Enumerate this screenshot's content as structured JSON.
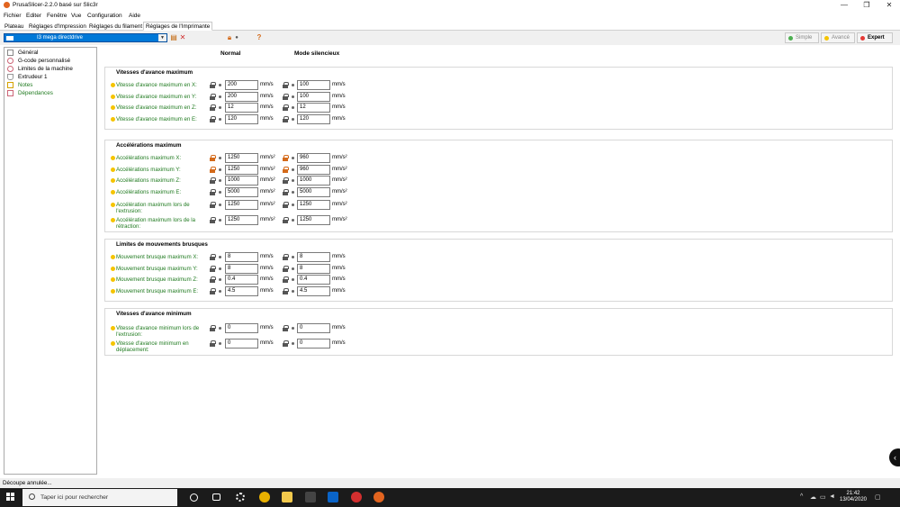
{
  "window": {
    "title": "PrusaSlicer-2.2.0 basé sur Slic3r",
    "minimize": "—",
    "maximize": "❐",
    "close": "✕"
  },
  "menu": [
    "Fichier",
    "Editer",
    "Fenêtre",
    "Vue",
    "Configuration",
    "Aide"
  ],
  "tabs": [
    "Plateau",
    "Réglages d'Impression",
    "Réglages du filament",
    "Réglages de l'Imprimante"
  ],
  "toolbar": {
    "preset_name": "I3 mega directdrive",
    "help_icon": "question-icon",
    "modes": [
      {
        "label": "Simple",
        "color": "#4caf50",
        "active": false
      },
      {
        "label": "Avancé",
        "color": "#f5c400",
        "active": false
      },
      {
        "label": "Expert",
        "color": "#e53935",
        "active": true
      }
    ]
  },
  "tree": [
    {
      "label": "Général",
      "icon": "printer-icon"
    },
    {
      "label": "G-code personnalisé",
      "icon": "cog-icon"
    },
    {
      "label": "Limites de la machine",
      "icon": "cog-icon"
    },
    {
      "label": "Extrudeur 1",
      "icon": "extruder-icon"
    },
    {
      "label": "Notes",
      "icon": "note-icon"
    },
    {
      "label": "Dépendances",
      "icon": "wrench-icon"
    }
  ],
  "columns": {
    "normal": "Normal",
    "silent": "Mode silencieux"
  },
  "groups": [
    {
      "title": "Vitesses d'avance maximum",
      "rows": [
        {
          "label": "Vitesse d'avance maximum en X:",
          "normal": "200",
          "silent": "100",
          "unit": "mm/s",
          "lock_orange": false
        },
        {
          "label": "Vitesse d'avance maximum en Y:",
          "normal": "200",
          "silent": "100",
          "unit": "mm/s",
          "lock_orange": false
        },
        {
          "label": "Vitesse d'avance maximum en Z:",
          "normal": "12",
          "silent": "12",
          "unit": "mm/s",
          "lock_orange": false
        },
        {
          "label": "Vitesse d'avance maximum en E:",
          "normal": "120",
          "silent": "120",
          "unit": "mm/s",
          "lock_orange": false
        }
      ]
    },
    {
      "title": "Accélérations maximum",
      "rows": [
        {
          "label": "Accélérations maximum X:",
          "normal": "1250",
          "silent": "960",
          "unit": "mm/s²",
          "lock_orange": true
        },
        {
          "label": "Accélérations maximum Y:",
          "normal": "1250",
          "silent": "960",
          "unit": "mm/s²",
          "lock_orange": true
        },
        {
          "label": "Accélérations maximum Z:",
          "normal": "1000",
          "silent": "1000",
          "unit": "mm/s²",
          "lock_orange": false
        },
        {
          "label": "Accélérations maximum E:",
          "normal": "5000",
          "silent": "5000",
          "unit": "mm/s²",
          "lock_orange": false
        },
        {
          "label": "Accélération maximum lors de l'extrusion:",
          "normal": "1250",
          "silent": "1250",
          "unit": "mm/s²",
          "lock_orange": false
        },
        {
          "label": "Accélération maximum lors de la rétraction:",
          "normal": "1250",
          "silent": "1250",
          "unit": "mm/s²",
          "lock_orange": false
        }
      ]
    },
    {
      "title": "Limites de mouvements brusques",
      "rows": [
        {
          "label": "Mouvement brusque maximum X:",
          "normal": "8",
          "silent": "8",
          "unit": "mm/s",
          "lock_orange": false
        },
        {
          "label": "Mouvement brusque maximum Y:",
          "normal": "8",
          "silent": "8",
          "unit": "mm/s",
          "lock_orange": false
        },
        {
          "label": "Mouvement brusque maximum Z:",
          "normal": "0.4",
          "silent": "0.4",
          "unit": "mm/s",
          "lock_orange": false
        },
        {
          "label": "Mouvement brusque maximum E:",
          "normal": "4.5",
          "silent": "4.5",
          "unit": "mm/s",
          "lock_orange": false
        }
      ]
    },
    {
      "title": "Vitesses d'avance minimum",
      "rows": [
        {
          "label": "Vitesse d'avance minimum lors de l'extrusion:",
          "normal": "0",
          "silent": "0",
          "unit": "mm/s",
          "lock_orange": false
        },
        {
          "label": "Vitesse d'avance minimum en déplacement:",
          "normal": "0",
          "silent": "0",
          "unit": "mm/s",
          "lock_orange": false
        }
      ]
    }
  ],
  "status": "Découpe annulée...",
  "taskbar": {
    "search_placeholder": "Taper ici pour rechercher",
    "time": "21:42",
    "date": "13/04/2020",
    "apps": [
      {
        "icon": "cortana-icon",
        "color": "#1b1b1b"
      },
      {
        "icon": "task-view-icon",
        "color": "#1b1b1b"
      },
      {
        "icon": "settings-icon",
        "color": "#1b1b1b"
      },
      {
        "icon": "chrome-icon",
        "color": "#e8b000"
      },
      {
        "icon": "file-explorer-icon",
        "color": "#f2c94c"
      },
      {
        "icon": "store-icon",
        "color": "#444444"
      },
      {
        "icon": "mail-icon",
        "color": "#0a64c8"
      },
      {
        "icon": "app-red-icon",
        "color": "#d32f2f"
      },
      {
        "icon": "prusaslicer-icon",
        "color": "#e2641f"
      }
    ]
  }
}
